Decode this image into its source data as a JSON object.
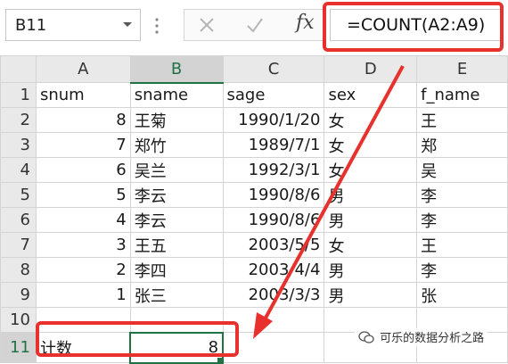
{
  "name_box": {
    "value": "B11"
  },
  "formula_bar": {
    "cancel_icon": "close-icon",
    "enter_icon": "check-icon",
    "fx_label": "fx",
    "formula": "=COUNT(A2:A9)"
  },
  "columns": [
    "A",
    "B",
    "C",
    "D",
    "E"
  ],
  "rows": [
    {
      "num": "1",
      "a": "snum",
      "b": "sname",
      "c": "sage",
      "d": "sex",
      "e": "f_name"
    },
    {
      "num": "2",
      "a": "8",
      "b": "王菊",
      "c": "1990/1/20",
      "d": "女",
      "e": "王"
    },
    {
      "num": "3",
      "a": "7",
      "b": "郑竹",
      "c": "1989/7/1",
      "d": "女",
      "e": "郑"
    },
    {
      "num": "4",
      "a": "6",
      "b": "吴兰",
      "c": "1992/3/1",
      "d": "女",
      "e": "吴"
    },
    {
      "num": "5",
      "a": "5",
      "b": "李云",
      "c": "1990/8/6",
      "d": "男",
      "e": "李"
    },
    {
      "num": "6",
      "a": "4",
      "b": "李云",
      "c": "1990/8/6",
      "d": "男",
      "e": "李"
    },
    {
      "num": "7",
      "a": "3",
      "b": "王五",
      "c": "2003/5/5",
      "d": "女",
      "e": "王"
    },
    {
      "num": "8",
      "a": "2",
      "b": "李四",
      "c": "2003/4/4",
      "d": "男",
      "e": "李"
    },
    {
      "num": "9",
      "a": "1",
      "b": "张三",
      "c": "2003/3/3",
      "d": "男",
      "e": "张"
    },
    {
      "num": "10",
      "a": "",
      "b": "",
      "c": "",
      "d": "",
      "e": ""
    },
    {
      "num": "11",
      "a": "计数",
      "b": "8",
      "c": "",
      "d": "",
      "e": ""
    }
  ],
  "watermark": {
    "text": "可乐的数据分析之路"
  },
  "colors": {
    "highlight": "#e8302c",
    "selection": "#217346"
  }
}
